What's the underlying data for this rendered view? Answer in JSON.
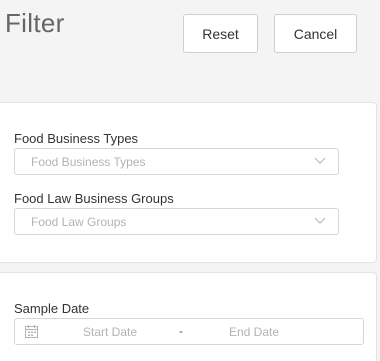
{
  "header": {
    "title": "Filter",
    "reset_label": "Reset",
    "cancel_label": "Cancel"
  },
  "filters": {
    "business_types": {
      "label": "Food Business Types",
      "placeholder": "Food Business Types"
    },
    "law_groups": {
      "label": "Food Law Business Groups",
      "placeholder": "Food Law Groups"
    }
  },
  "sample_date": {
    "label": "Sample Date",
    "start_placeholder": "Start Date",
    "separator": "-",
    "end_placeholder": "End Date"
  },
  "icons": {
    "dropdown": "chevron-down-icon",
    "date": "calendar-icon"
  },
  "colors": {
    "background": "#f4f4f4",
    "placeholder": "#b3b3b3",
    "border": "#d6d6d6"
  }
}
